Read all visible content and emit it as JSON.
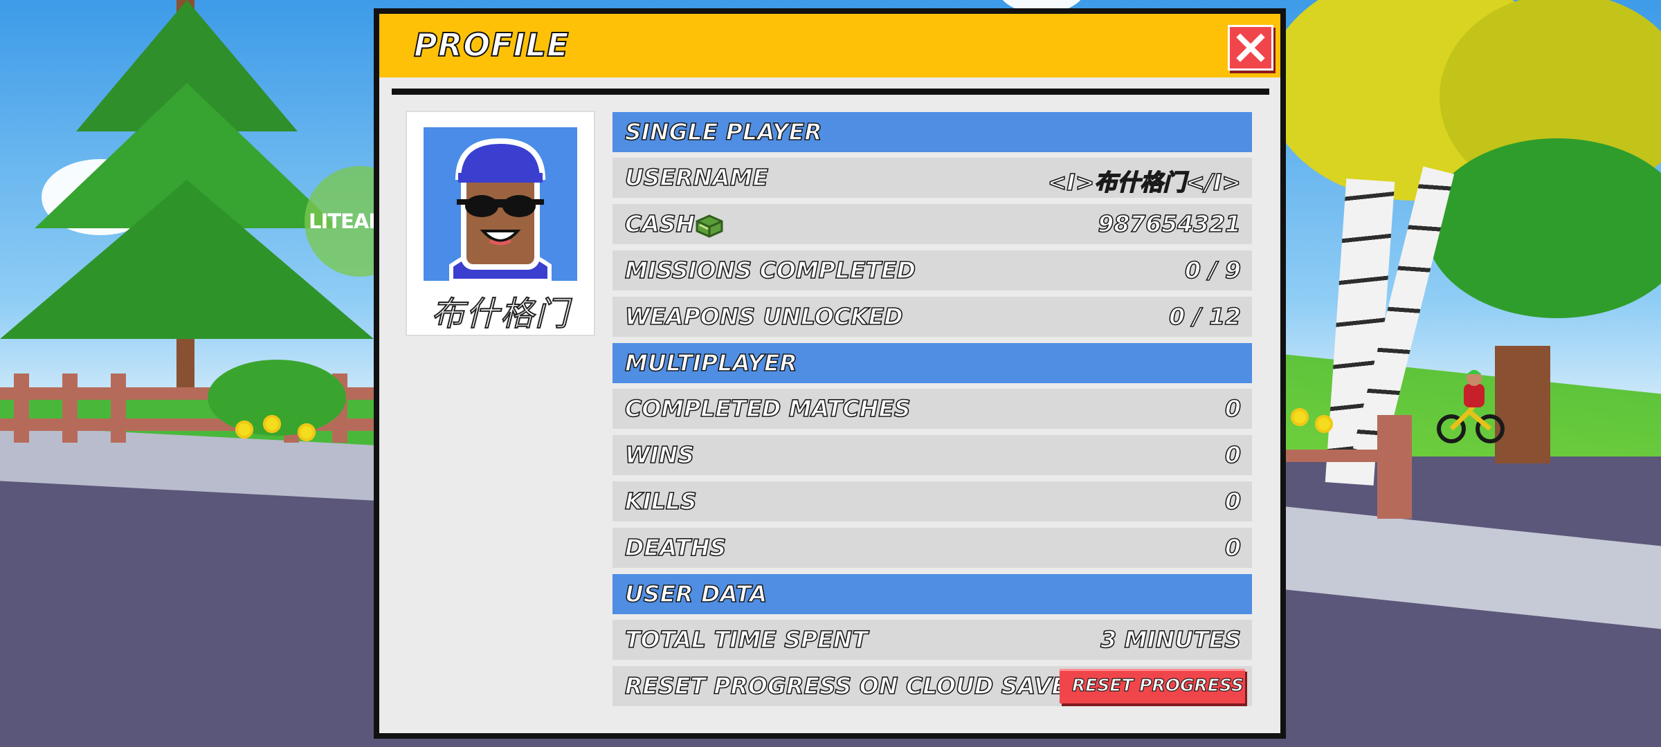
{
  "watermark": "LITEAPKS",
  "modal": {
    "title": "PROFILE",
    "close_icon": "close-x-icon"
  },
  "profile": {
    "display_name": "布什格门",
    "avatar": "player-avatar-blue-cap-sunglasses"
  },
  "single_player": {
    "heading": "SINGLE PLAYER",
    "rows": [
      {
        "label": "USERNAME",
        "value": "<I>布什格门</I>"
      },
      {
        "label": "CASH",
        "value": "987654321",
        "icon": "cash-stack-icon"
      },
      {
        "label": "MISSIONS COMPLETED",
        "value": "0 / 9"
      },
      {
        "label": "WEAPONS UNLOCKED",
        "value": "0 / 12"
      }
    ]
  },
  "multiplayer": {
    "heading": "MULTIPLAYER",
    "rows": [
      {
        "label": "COMPLETED MATCHES",
        "value": "0"
      },
      {
        "label": "WINS",
        "value": "0"
      },
      {
        "label": "KILLS",
        "value": "0"
      },
      {
        "label": "DEATHS",
        "value": "0"
      }
    ]
  },
  "user_data": {
    "heading": "USER DATA",
    "rows": [
      {
        "label": "TOTAL TIME SPENT",
        "value": "3 MINUTES"
      },
      {
        "label": "RESET PROGRESS ON CLOUD SAVE",
        "button": "RESET PROGRESS"
      }
    ]
  },
  "colors": {
    "header": "#ffc107",
    "section": "#4f8ee3",
    "row": "#d9d9d9",
    "danger": "#f0464b"
  }
}
